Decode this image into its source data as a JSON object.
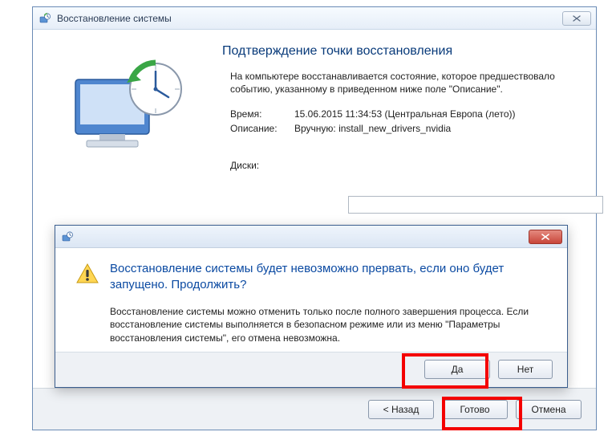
{
  "window": {
    "title": "Восстановление системы"
  },
  "page": {
    "heading": "Подтверждение точки восстановления",
    "description": "На компьютере восстанавливается состояние, которое предшествовало событию, указанному в приведенном ниже поле \"Описание\".",
    "time_label": "Время:",
    "time_value": "15.06.2015 11:34:53 (Центральная Европа (лето))",
    "desc_label": "Описание:",
    "desc_value": "Вручную: install_new_drivers_nvidia",
    "disks_label": "Диски:"
  },
  "footer": {
    "back": "< Назад",
    "finish": "Готово",
    "cancel": "Отмена"
  },
  "confirm": {
    "main_text": "Восстановление системы будет невозможно прервать, если оно будет запущено. Продолжить?",
    "sub_text": "Восстановление системы можно отменить только после полного завершения процесса. Если восстановление системы выполняется в безопасном режиме или из меню \"Параметры восстановления системы\", его отмена невозможна.",
    "yes": "Да",
    "no": "Нет"
  },
  "icons": {
    "restore": "restore-icon",
    "warning": "warning-icon"
  }
}
